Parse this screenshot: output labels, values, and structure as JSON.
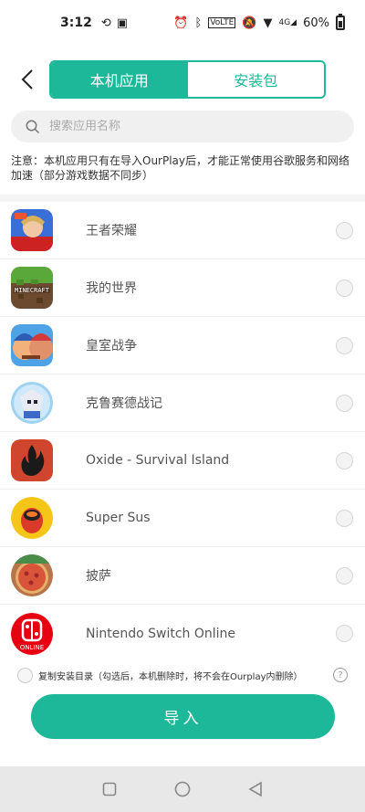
{
  "status_bar": {
    "time": "3:12",
    "network": "4G",
    "battery": "60%",
    "battery_level": 0.6
  },
  "header": {
    "tabs": [
      {
        "label": "本机应用",
        "active": true
      },
      {
        "label": "安装包",
        "active": false
      }
    ]
  },
  "search": {
    "placeholder": "搜索应用名称",
    "value": ""
  },
  "notice": "注意：本机应用只有在导入OurPlay后，才能正常使用谷歌服务和网络加速（部分游戏数据不同步）",
  "apps": [
    {
      "name": "王者荣耀",
      "icon": "honor-of-kings-icon"
    },
    {
      "name": "我的世界",
      "icon": "minecraft-icon"
    },
    {
      "name": "皇室战争",
      "icon": "clash-royale-icon"
    },
    {
      "name": "克鲁赛德战记",
      "icon": "crusaders-quest-icon"
    },
    {
      "name": "Oxide - Survival Island",
      "icon": "oxide-icon"
    },
    {
      "name": "Super Sus",
      "icon": "super-sus-icon"
    },
    {
      "name": "披萨",
      "icon": "pizza-icon"
    },
    {
      "name": "Nintendo Switch Online",
      "icon": "nintendo-switch-online-icon"
    }
  ],
  "copy_option": {
    "label": "复制安装目录（勾选后，本机删除时，将不会在Ourplay内删除）",
    "help": "?"
  },
  "import_button": "导入",
  "colors": {
    "accent": "#1db89a"
  }
}
